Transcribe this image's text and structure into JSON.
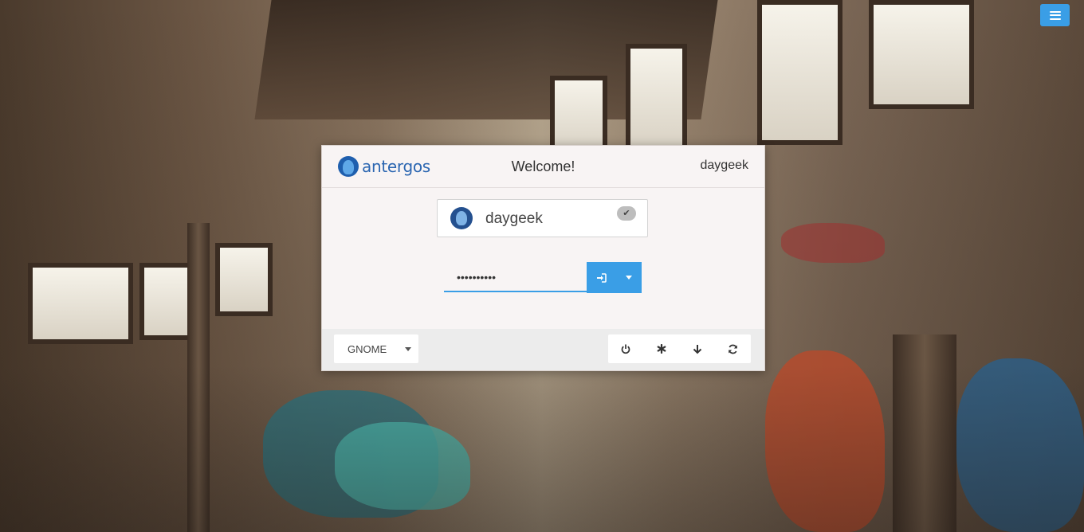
{
  "header": {
    "logo_text": "antergos",
    "welcome": "Welcome!",
    "current_user": "daygeek"
  },
  "user_card": {
    "name": "daygeek"
  },
  "password": {
    "value": "••••••••••"
  },
  "footer": {
    "session": "GNOME"
  },
  "icons": {
    "menu": "hamburger-icon",
    "logo": "antergos-logo-icon",
    "avatar": "user-avatar-icon",
    "check": "check-icon",
    "login": "sign-in-icon",
    "dropdown": "caret-down-icon",
    "power": "power-icon",
    "accessibility": "asterisk-icon",
    "suspend": "arrow-down-icon",
    "restart": "refresh-icon"
  },
  "colors": {
    "accent": "#3a9ee6",
    "logo_blue": "#2b66b1"
  }
}
